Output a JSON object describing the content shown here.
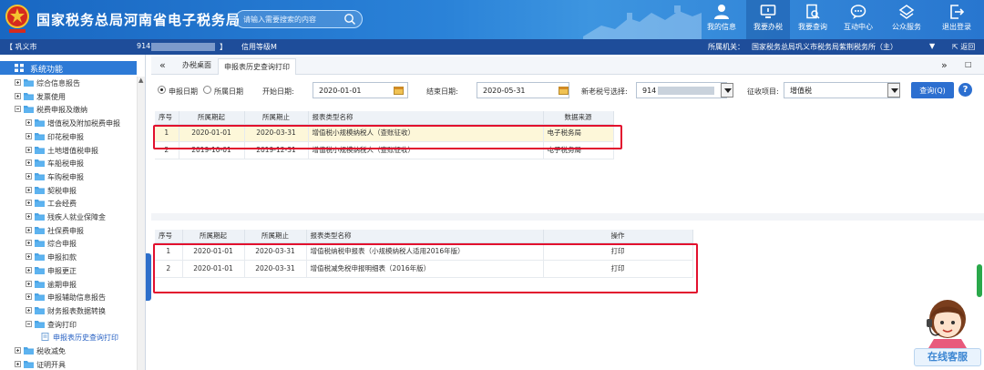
{
  "header": {
    "title": "国家税务总局河南省电子税务局",
    "search_placeholder": "请输入需要搜索的内容",
    "nav": [
      "我的信息",
      "我要办税",
      "我要查询",
      "互动中心",
      "公众服务",
      "退出登录"
    ]
  },
  "infobar": {
    "city": "【 巩义市",
    "taxid_prefix": "914",
    "bracket": "】",
    "credit": "信用等级M",
    "org_label": "所属机关：",
    "org_value": "国家税务总局巩义市税务局紫荆税务所（主）",
    "back": "返回"
  },
  "sidebar": {
    "title": "系统功能",
    "items": [
      {
        "label": "综合信息报告",
        "level": 1,
        "expand": "plus"
      },
      {
        "label": "发票使用",
        "level": 1,
        "expand": "plus"
      },
      {
        "label": "税费申报及缴纳",
        "level": 1,
        "expand": "minus"
      },
      {
        "label": "增值税及附加税费申报",
        "level": 2,
        "expand": "plus"
      },
      {
        "label": "印花税申报",
        "level": 2,
        "expand": "plus"
      },
      {
        "label": "土地增值税申报",
        "level": 2,
        "expand": "plus"
      },
      {
        "label": "车船税申报",
        "level": 2,
        "expand": "plus"
      },
      {
        "label": "车购税申报",
        "level": 2,
        "expand": "plus"
      },
      {
        "label": "契税申报",
        "level": 2,
        "expand": "plus"
      },
      {
        "label": "工会经费",
        "level": 2,
        "expand": "plus"
      },
      {
        "label": "残疾人就业保障金",
        "level": 2,
        "expand": "plus"
      },
      {
        "label": "社保费申报",
        "level": 2,
        "expand": "plus"
      },
      {
        "label": "综合申报",
        "level": 2,
        "expand": "plus"
      },
      {
        "label": "申报扣款",
        "level": 2,
        "expand": "plus"
      },
      {
        "label": "申报更正",
        "level": 2,
        "expand": "plus"
      },
      {
        "label": "逾期申报",
        "level": 2,
        "expand": "plus"
      },
      {
        "label": "申报辅助信息报告",
        "level": 2,
        "expand": "plus"
      },
      {
        "label": "财务报表数据转换",
        "level": 2,
        "expand": "plus"
      },
      {
        "label": "查询打印",
        "level": 2,
        "expand": "minus"
      },
      {
        "label": "申报表历史查询打印",
        "level": 3,
        "expand": "none"
      },
      {
        "label": "税收减免",
        "level": 1,
        "expand": "plus"
      },
      {
        "label": "证明开具",
        "level": 1,
        "expand": "plus"
      }
    ]
  },
  "tabs": {
    "back_arrows": "«",
    "home": "办税桌面",
    "current": "申报表历史查询打印",
    "forward_arrows": "»",
    "square": "□"
  },
  "filter": {
    "radio_declare": "申报日期",
    "radio_period": "所属日期",
    "start_label": "开始日期:",
    "start_value": "2020-01-01",
    "end_label": "结束日期:",
    "end_value": "2020-05-31",
    "taxid_label": "新老税号选择:",
    "taxid_value": "914",
    "levy_label": "征收项目:",
    "levy_value": "增值税",
    "query_button": "查询(Q)",
    "help": "?"
  },
  "table1": {
    "headers": [
      "序号",
      "所属期起",
      "所属期止",
      "报表类型名称",
      "数据来源"
    ],
    "rows": [
      [
        "1",
        "2020-01-01",
        "2020-03-31",
        "增值税小规模纳税人（查账征收）",
        "电子税务局"
      ],
      [
        "2",
        "2019-10-01",
        "2019-12-31",
        "增值税小规模纳税人（查账征收）",
        "电子税务局"
      ]
    ]
  },
  "table2": {
    "headers": [
      "序号",
      "所属期起",
      "所属期止",
      "报表类型名称",
      "操作"
    ],
    "rows": [
      [
        "1",
        "2020-01-01",
        "2020-03-31",
        "增值税纳税申报表（小规模纳税人适用2016年版）",
        "打印"
      ],
      [
        "2",
        "2020-01-01",
        "2020-03-31",
        "增值税减免税申报明细表（2016年版）",
        "打印"
      ]
    ]
  },
  "support": {
    "label": "在线客服"
  },
  "colors": {
    "header_blue": "#2a82d8",
    "infobar_blue": "#1e4d9a",
    "highlight_red": "#e2102e",
    "button_blue": "#2c6fd0"
  }
}
